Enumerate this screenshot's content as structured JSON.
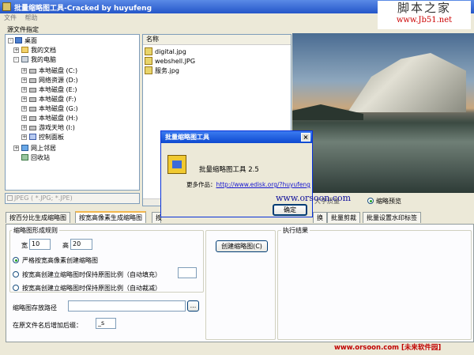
{
  "window": {
    "title": "批量缩略图工具-Cracked by huyufeng"
  },
  "watermark_top": {
    "cn": "脚本之家",
    "url": "www.Jb51.net"
  },
  "menu": {
    "file": "文件",
    "help": "帮助"
  },
  "source_label": "源文件指定",
  "tree": {
    "desktop": "桌面",
    "my_docs": "我的文档",
    "my_pc": "我的电脑",
    "drives": [
      "本地磁盘 (C:)",
      "网络资源 (D:)",
      "本地磁盘 (E:)",
      "本地磁盘 (F:)",
      "本地磁盘 (G:)",
      "本地磁盘 (H:)",
      "游戏天地 (I:)"
    ],
    "control_panel": "控制面板",
    "network": "网上邻居",
    "recycle": "回收站"
  },
  "filter": {
    "label": "JPEG ( *.JPG; *.JPE)"
  },
  "files": {
    "header": "名称",
    "items": [
      "digital.jpg",
      "webshell.JPG",
      "服务.jpg"
    ]
  },
  "preview": {
    "large_label": "大图显示",
    "quality_label": "大字质量",
    "thumb_label": "缩略预览"
  },
  "tabs": [
    "按百分比生成缩略图",
    "按宽高像素生成缩略图",
    "按",
    "换",
    "批量剪裁",
    "批量设置水印标签"
  ],
  "rules": {
    "group_title": "缩略图形成规则",
    "width_label": "宽",
    "width_value": "10",
    "height_label": "高",
    "height_value": "20",
    "option1": "严格按宽高像素创建缩略图",
    "option2": "按宽高创建立缩略图时保持原图比例（自动填充）",
    "option3": "按宽高创建立缩略图时保持原图比例（自动裁减）",
    "create_button": "创建缩略图(C)",
    "result_title": "执行结果",
    "output_path_label": "缩略图存放路径",
    "browse_button": "...",
    "suffix_label": "在原文件名后增加后缀：",
    "suffix_value": "_s"
  },
  "dialog": {
    "title": "批量缩略图工具",
    "product": "批量缩略图工具 2.5",
    "more_label": "更多作品：",
    "link": "http://www.edisk.org/?huyufeng",
    "ok_button": "确定",
    "close_glyph": "×"
  },
  "overlay_watermark": "www.orsoon.com",
  "footer_watermark": "www.orsoon.com [未来软件园]"
}
